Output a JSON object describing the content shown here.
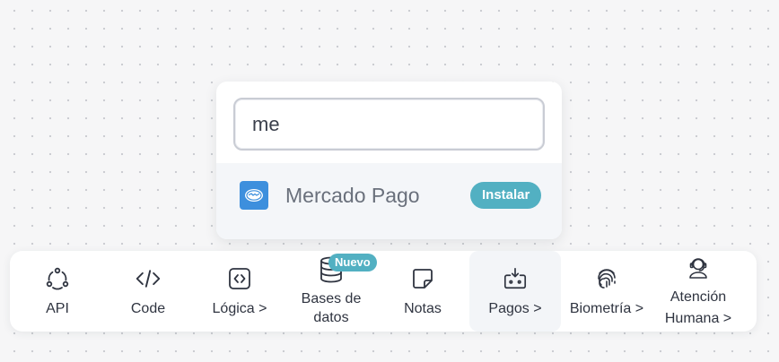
{
  "search": {
    "value": "me"
  },
  "result": {
    "name": "Mercado Pago",
    "install_label": "Instalar"
  },
  "toolbar": {
    "items": [
      {
        "label": "API"
      },
      {
        "label": "Code"
      },
      {
        "label": "Lógica >"
      },
      {
        "label_line1": "Bases de",
        "label_line2": "datos",
        "badge": "Nuevo"
      },
      {
        "label": "Notas"
      },
      {
        "label": "Pagos >"
      },
      {
        "label": "Biometría >"
      },
      {
        "label_line1": "Atención",
        "label_line2": "Humana >"
      }
    ]
  },
  "colors": {
    "accent": "#52b0c2",
    "mercado_pago": "#3d8fdd",
    "toolbar_active": "#f3f5f8"
  }
}
